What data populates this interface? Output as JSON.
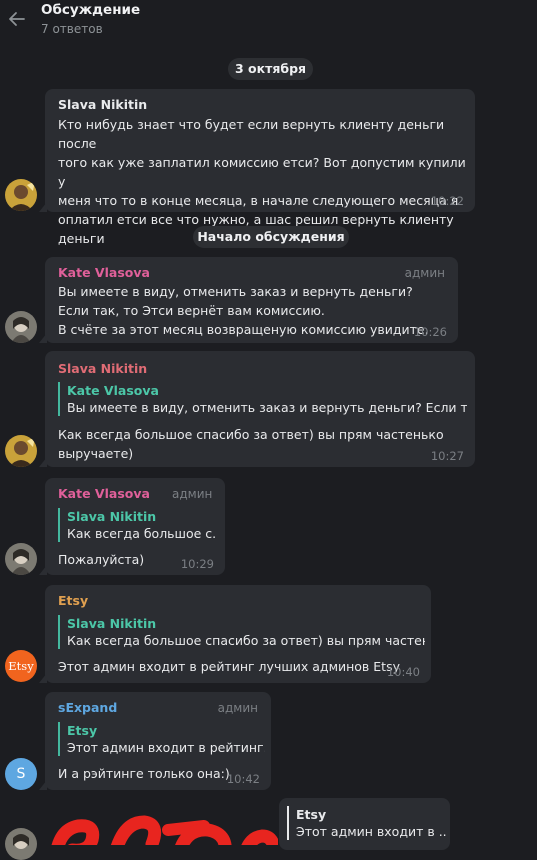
{
  "header": {
    "title": "Обсуждение",
    "subtitle": "7 ответов"
  },
  "dates": {
    "date1": "3 октября",
    "discussion_start": "Начало обсуждения"
  },
  "messages": [
    {
      "author": "Slava Nikitin",
      "author_color": "#e06c75",
      "text": "Кто нибудь знает что будет если вернуть клиенту деньги после\nтого как уже заплатил комиссию етси? Вот допустим купили у\nменя что то в конце месяца, в начале следующего месяца я\nоплатил етси все что нужно, а шас решил вернуть клиенту\nденьги",
      "time": "10:22"
    },
    {
      "author": "Kate Vlasova",
      "author_color": "#e0609a",
      "role": "админ",
      "text": "Вы имеете в виду, отменить заказ и вернуть деньги?\nЕсли так, то Этси вернёт вам комиссию.\nВ счёте за этот месяц возвращеную комиссию увидите.",
      "time": "10:26"
    },
    {
      "author": "Slava Nikitin",
      "author_color": "#e06c75",
      "quote_author": "Kate Vlasova",
      "quote_text": "Вы имеете в виду, отменить заказ и вернуть деньги? Если так...",
      "text": "Как всегда большое спасибо за ответ) вы прям частенько\nвыручаете)",
      "time": "10:27"
    },
    {
      "author": "Kate Vlasova",
      "author_color": "#e0609a",
      "role": "админ",
      "quote_author": "Slava Nikitin",
      "quote_text": "Как всегда большое с...",
      "text": "Пожалуйста)",
      "time": "10:29"
    },
    {
      "author": "Etsy",
      "author_color": "#e0a050",
      "avatar_text": "Etsy",
      "quote_author": "Slava Nikitin",
      "quote_text": "Как всегда большое спасибо за ответ) вы прям частен...",
      "text": "Этот админ входит в рейтинг лучших админов Etsy",
      "time": "10:40"
    },
    {
      "author": "sExpand",
      "author_color": "#5ea7e1",
      "role": "админ",
      "avatar_letter": "S",
      "quote_author": "Etsy",
      "quote_text": "Этот админ входит в рейтинг...",
      "text": "И а рэйтинге только она:)",
      "time": "10:42"
    },
    {
      "quote_author": "Etsy",
      "quote_text": "Этот админ входит в ..."
    }
  ],
  "colors": {
    "background": "#1c1d21",
    "bubble": "#2b2d32",
    "quote_accent": "#44b89f",
    "sticker": "#e8251f"
  },
  "icons": {
    "back": "arrow-left-icon"
  }
}
